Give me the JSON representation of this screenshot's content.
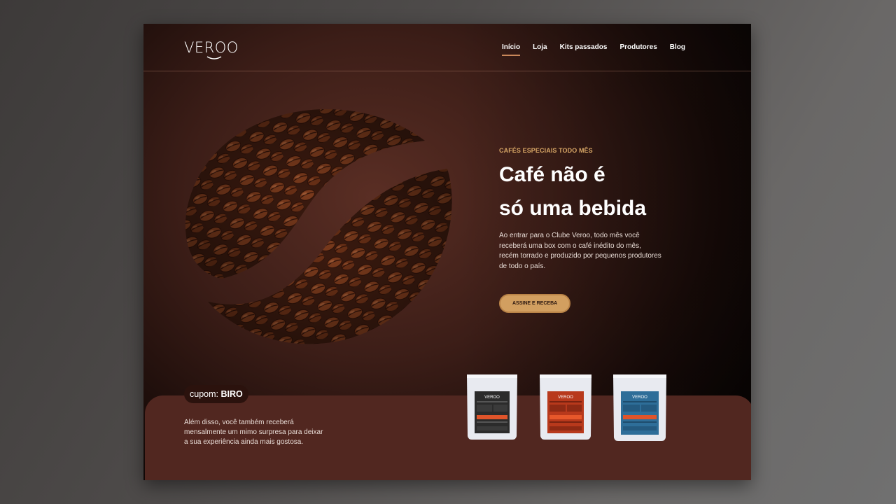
{
  "brand": {
    "logo_text": "VEROO"
  },
  "nav": {
    "items": [
      {
        "label": "Início",
        "active": true
      },
      {
        "label": "Loja",
        "active": false
      },
      {
        "label": "Kits passados",
        "active": false
      },
      {
        "label": "Produtores",
        "active": false
      },
      {
        "label": "Blog",
        "active": false
      }
    ]
  },
  "hero": {
    "eyebrow": "CAFÉS ESPECIAIS TODO MÊS",
    "title_line1": "Café não é",
    "title_line2": "só uma bebida",
    "description": "Ao entrar para o Clube Veroo, todo mês você receberá uma box com o café inédito do mês, recém torrado e produzido por pequenos produtores de todo o país.",
    "cta_label": "ASSINE E RECEBA"
  },
  "promo": {
    "coupon_prefix": "cupom: ",
    "coupon_code": "BIRO",
    "text": "Além disso, você também receberá mensalmente um mimo surpresa para deixar a sua experiência ainda mais gostosa."
  },
  "products": [
    {
      "icon": "coffee-bag-icon",
      "label_color": "#2b2b2b",
      "accent": "#e0542a",
      "label_text": "VEROO"
    },
    {
      "icon": "coffee-bag-icon",
      "label_color": "#b8391c",
      "accent": "#e7582b",
      "label_text": "VEROO"
    },
    {
      "icon": "coffee-bag-icon",
      "label_color": "#2e6e99",
      "accent": "#e0542a",
      "label_text": "VEROO"
    }
  ],
  "colors": {
    "accent_gold": "#d29f60",
    "eyebrow": "#d6a565",
    "band": "#512720",
    "nav_underline": "#c9875a"
  }
}
